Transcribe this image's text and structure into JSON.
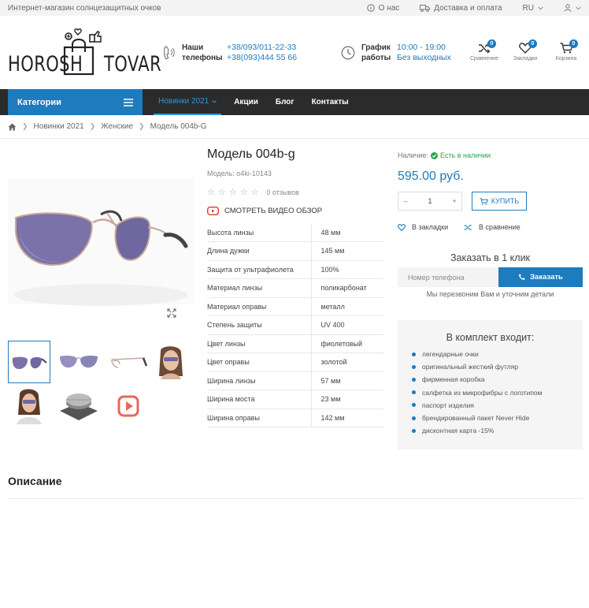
{
  "topbar": {
    "tagline": "Интернет-магазин солнцезащитных очков",
    "about": "О нас",
    "delivery": "Доставка и оплата",
    "lang": "RU"
  },
  "header": {
    "logo_word1": "HOROSH",
    "logo_word2": "TOVAR",
    "phones_label_1": "Наши",
    "phones_label_2": "телефоны",
    "phone1": "+38/093/011-22-33",
    "phone2": "+38(093)444 55 66",
    "schedule_label_1": "График",
    "schedule_label_2": "работы",
    "hours": "10:00 - 19:00",
    "days": "Без выходных",
    "compare": {
      "label": "Сравнение",
      "count": "0"
    },
    "wishlist": {
      "label": "Закладки",
      "count": "0"
    },
    "cart": {
      "label": "Корзина",
      "count": "0"
    }
  },
  "nav": {
    "categories": "Категории",
    "items": [
      "Новинки 2021",
      "Акции",
      "Блог",
      "Контакты"
    ]
  },
  "breadcrumb": [
    "Новинки 2021",
    "Женские",
    "Модель 004b-G"
  ],
  "product": {
    "title": "Модель 004b-g",
    "model": "Модель: o4ki-10143",
    "reviews": "0 отзывов",
    "rating": 0,
    "video": "СМОТРЕТЬ ВИДЕО ОБЗОР",
    "specs": [
      {
        "k": "Высота линзы",
        "v": "48 мм"
      },
      {
        "k": "Длина дужки",
        "v": "145 мм"
      },
      {
        "k": "Защита от ультрафиолета",
        "v": "100%"
      },
      {
        "k": "Материал линзы",
        "v": "поликарбонат"
      },
      {
        "k": "Материал оправы",
        "v": "металл"
      },
      {
        "k": "Степень защиты",
        "v": "UV 400"
      },
      {
        "k": "Цвет линзы",
        "v": "фиолетовый"
      },
      {
        "k": "Цвет оправы",
        "v": "золотой"
      },
      {
        "k": "Ширина линзы",
        "v": "57 мм"
      },
      {
        "k": "Ширина моста",
        "v": "23 мм"
      },
      {
        "k": "Ширина оправы",
        "v": "142 мм"
      }
    ]
  },
  "buy": {
    "availability_label": "Наличие:",
    "availability": "Есть в наличии",
    "price": "595.00 руб.",
    "qty": "1",
    "buy_label": "КУПИТЬ",
    "wishlist_label": "В закладки",
    "compare_label": "В сравнение",
    "oneclick_title": "Заказать в 1 клик",
    "phone_placeholder": "Номер телефона",
    "order_label": "Заказать",
    "callback": "Мы перезвоним Вам и уточним детали"
  },
  "kit": {
    "title": "В комплект входит:",
    "items": [
      "легендарные очки",
      "оригинальный жесткий футляр",
      "фирменная коробка",
      "салфетка из микрофибры с логотипом",
      "паспорт изделия",
      "брендированный пакет Never Hide",
      "дисконтная карта -15%"
    ]
  },
  "description_title": "Описание",
  "colors": {
    "accent": "#1e7bbd",
    "nav_bg": "#2b2b2b",
    "in_stock": "#2aa548"
  }
}
